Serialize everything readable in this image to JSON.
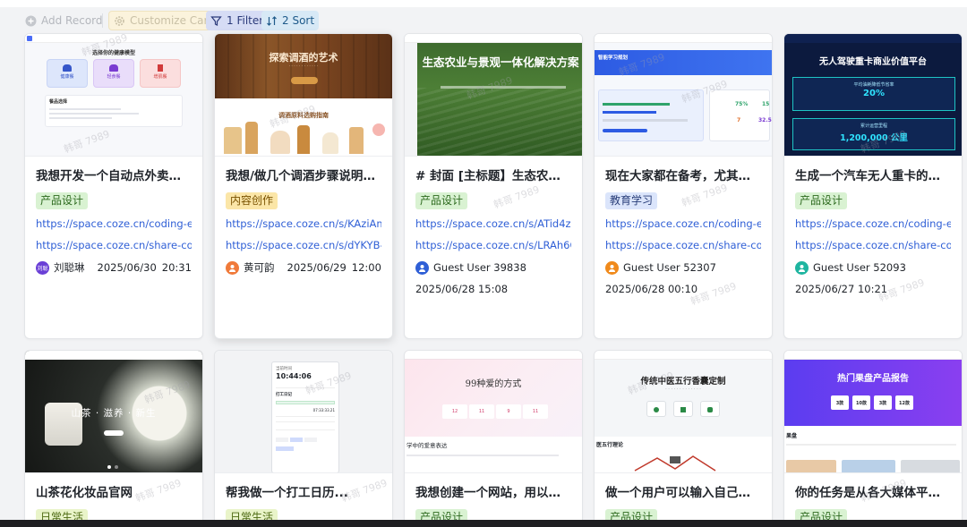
{
  "toolbar": {
    "add_record": "Add Record",
    "customize_card": "Customize Card",
    "filter": "1 Filter",
    "sort": "2 Sort"
  },
  "watermark": "韩哥 7989",
  "cards": [
    {
      "title": "我想开发一个自动点外卖的应...",
      "tag": "产品设计",
      "link1": "https://space.coze.cn/coding-exper",
      "link2": "https://space.coze.cn/share-coding",
      "user": "刘聪琳",
      "date": "2025/06/30",
      "time": "20:31",
      "thumb": {
        "heading": "选择你的健康模型",
        "b1": "健康餐",
        "b2": "轻食餐",
        "b3": "增肌餐",
        "sub": "餐品选择"
      }
    },
    {
      "title": "我想/做几个调酒步骤说明的手...",
      "tag": "内容创作",
      "link1": "https://space.coze.cn/s/KAziAm6BN",
      "link2": "https://space.coze.cn/s/dYKYB-5fK",
      "user": "黄可韵",
      "date": "2025/06/29",
      "time": "12:00",
      "thumb": {
        "heading": "探索调酒的艺术",
        "sub": "调酒原料选购指南"
      }
    },
    {
      "title": "# 封面 [主标题】生态农业与景...",
      "tag": "产品设计",
      "link1": "https://space.coze.cn/s/ATid4z-cSP",
      "link2": "https://space.coze.cn/s/LRAh6O7M",
      "user": "Guest User 39838",
      "date": "2025/06/28 15:08",
      "thumb": {
        "heading": "生态农业与景观一体化解决方案"
      }
    },
    {
      "title": "现在大家都在备考，尤其是考...",
      "tag": "教育学习",
      "link1": "https://space.coze.cn/coding-exper",
      "link2": "https://space.coze.cn/share-coding",
      "user": "Guest User 52307",
      "date": "2025/06/28 00:10",
      "thumb": {
        "heading": "智能学习规划",
        "v1": "75%",
        "v2": "15",
        "v3": "7",
        "v4": "32.5"
      }
    },
    {
      "title": "生成一个汽车无人重卡的网页",
      "tag": "产品设计",
      "link1": "https://space.coze.cn/coding-exper",
      "link2": "https://space.coze.cn/share-coding",
      "user": "Guest User 52093",
      "date": "2025/06/27 10:21",
      "thumb": {
        "heading": "无人驾驶重卡商业价值平台",
        "k1": "平均油耗降低节省率",
        "v1": "20%",
        "k2": "累计运营里程",
        "v2": "1,200,000 公里"
      }
    },
    {
      "title": "山茶花化妆品官网",
      "tag": "日常生活",
      "thumb": {
        "heading": "山茶 · 滋养 · 新生"
      }
    },
    {
      "title": "帮我做一个打工日历...",
      "tag": "日常生活",
      "thumb": {
        "clock": "10:44:06",
        "r1": "打工日记",
        "r2": "07:33:33.21"
      }
    },
    {
      "title": "我想创建一个网站，用以展示...",
      "tag": "产品设计",
      "thumb": {
        "heading": "99种爱的方式",
        "n1": "12",
        "n2": "11",
        "n3": "9",
        "n4": "11",
        "sub": "学中的爱意表达"
      }
    },
    {
      "title": "做一个用户可以输入自己生辰...",
      "tag": "产品设计",
      "thumb": {
        "heading": "传统中医五行香囊定制",
        "sub": "医五行理论"
      }
    },
    {
      "title": "你的任务是从各大媒体平台和...",
      "tag": "产品设计",
      "thumb": {
        "heading": "热门果盘产品报告",
        "c1": "3款",
        "c2": "10款",
        "c3": "3款",
        "c4": "12款",
        "sub": "果盘"
      }
    }
  ],
  "colors": {
    "link": "#2f5fd6",
    "tag_green": "#d9f2d2",
    "tag_yellow": "#fbe6a8",
    "tag_blue": "#dbe5fb"
  }
}
